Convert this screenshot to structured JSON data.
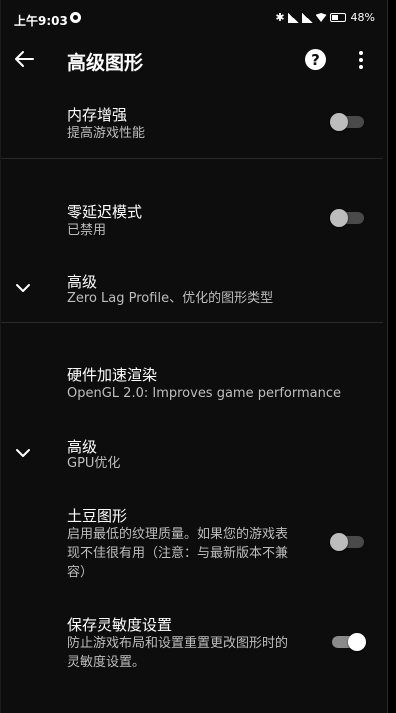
{
  "status_bar": {
    "time": "上午9:03",
    "battery": "48",
    "battery_unit": "%"
  },
  "app_bar": {
    "title": "高级图形",
    "help_label": "?"
  },
  "settings": {
    "memory_boost": {
      "title": "内存增强",
      "subtitle": "提高游戏性能",
      "enabled": false
    },
    "zero_lag": {
      "title": "零延迟模式",
      "subtitle": "已禁用",
      "enabled": false
    },
    "advanced_1": {
      "title": "高级",
      "subtitle": "Zero Lag Profile、优化的图形类型"
    },
    "hw_render": {
      "title": "硬件加速渲染",
      "subtitle": "OpenGL 2.0: Improves game performance"
    },
    "advanced_2": {
      "title": "高级",
      "subtitle": "GPU优化"
    },
    "potato": {
      "title": "土豆图形",
      "subtitle_lines": [
        "启用最低的纹理质量。如果您的游戏表",
        "现不佳很有用（注意：与最新版本不兼",
        "容）"
      ],
      "enabled": false
    },
    "save_sensitivity": {
      "title": "保存灵敏度设置",
      "subtitle_lines": [
        "防止游戏布局和设置重置更改图形时的",
        "灵敏度设置。"
      ],
      "enabled": true
    }
  },
  "icons": {
    "back": "arrow-left",
    "help": "question-circle",
    "more": "more-vertical",
    "expand": "chevron-down"
  }
}
